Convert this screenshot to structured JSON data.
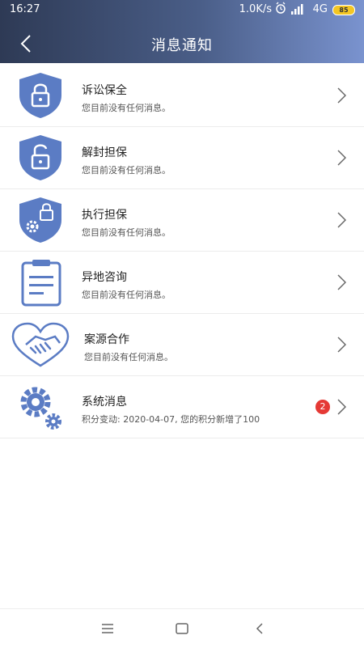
{
  "status_bar": {
    "time": "16:27",
    "network_speed": "1.0K/s",
    "network_type": "4G",
    "battery": "85",
    "alarm_icon": "alarm-clock-icon",
    "signal_icon": "signal-bars-icon"
  },
  "header": {
    "title": "消息通知",
    "back_icon": "back-arrow-icon"
  },
  "messages": [
    {
      "title": "诉讼保全",
      "desc": "您目前没有任何消息。",
      "icon": "shield-lock-icon"
    },
    {
      "title": "解封担保",
      "desc": "您目前没有任何消息。",
      "icon": "shield-unlock-icon"
    },
    {
      "title": "执行担保",
      "desc": "您目前没有任何消息。",
      "icon": "shield-gear-lock-icon"
    },
    {
      "title": "异地咨询",
      "desc": "您目前没有任何消息。",
      "icon": "clipboard-icon"
    },
    {
      "title": "案源合作",
      "desc": "您目前没有任何消息。",
      "icon": "handshake-icon"
    },
    {
      "title": "系统消息",
      "desc": "积分变动: 2020-04-07, 您的积分新增了100",
      "icon": "gears-icon",
      "badge": "2"
    }
  ],
  "colors": {
    "icon_blue": "#5b7cc4",
    "badge_red": "#e53935",
    "header_start": "#2e3a55",
    "header_end": "#7a93cf"
  },
  "system_nav": {
    "menu_icon": "menu-icon",
    "home_icon": "home-square-icon",
    "back_icon": "nav-back-icon"
  }
}
